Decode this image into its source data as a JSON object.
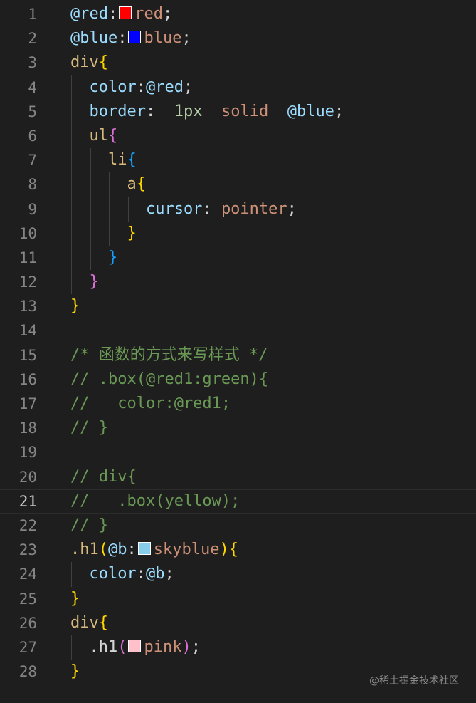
{
  "editor": {
    "lines": [
      {
        "number": "1",
        "guides": [],
        "tokens": [
          {
            "text": "@red",
            "color": "#9cdcfe"
          },
          {
            "text": ":",
            "color": "#d4d4d4"
          },
          {
            "swatch": "#ff0000"
          },
          {
            "text": "red",
            "color": "#ce9178"
          },
          {
            "text": ";",
            "color": "#d4d4d4"
          }
        ]
      },
      {
        "number": "2",
        "guides": [],
        "tokens": [
          {
            "text": "@blue",
            "color": "#9cdcfe"
          },
          {
            "text": ":",
            "color": "#d4d4d4"
          },
          {
            "swatch": "#0000ff"
          },
          {
            "text": "blue",
            "color": "#ce9178"
          },
          {
            "text": ";",
            "color": "#d4d4d4"
          }
        ]
      },
      {
        "number": "3",
        "guides": [],
        "tokens": [
          {
            "text": "div",
            "color": "#d7ba7d"
          },
          {
            "text": "{",
            "color": "#ffd700"
          }
        ]
      },
      {
        "number": "4",
        "guides": [
          1
        ],
        "tokens": [
          {
            "text": "  color",
            "color": "#9cdcfe"
          },
          {
            "text": ":",
            "color": "#d4d4d4"
          },
          {
            "text": "@red",
            "color": "#9cdcfe"
          },
          {
            "text": ";",
            "color": "#d4d4d4"
          }
        ]
      },
      {
        "number": "5",
        "guides": [
          1
        ],
        "tokens": [
          {
            "text": "  border",
            "color": "#9cdcfe"
          },
          {
            "text": ":  ",
            "color": "#d4d4d4"
          },
          {
            "text": "1px",
            "color": "#b5cea8"
          },
          {
            "text": "  ",
            "color": "#d4d4d4"
          },
          {
            "text": "solid",
            "color": "#ce9178"
          },
          {
            "text": "  ",
            "color": "#d4d4d4"
          },
          {
            "text": "@blue",
            "color": "#9cdcfe"
          },
          {
            "text": ";",
            "color": "#d4d4d4"
          }
        ]
      },
      {
        "number": "6",
        "guides": [
          1
        ],
        "tokens": [
          {
            "text": "  ul",
            "color": "#d7ba7d"
          },
          {
            "text": "{",
            "color": "#da70d6"
          }
        ]
      },
      {
        "number": "7",
        "guides": [
          1,
          2
        ],
        "tokens": [
          {
            "text": "    li",
            "color": "#d7ba7d"
          },
          {
            "text": "{",
            "color": "#179fff"
          }
        ]
      },
      {
        "number": "8",
        "guides": [
          1,
          2,
          3
        ],
        "tokens": [
          {
            "text": "      a",
            "color": "#d7ba7d"
          },
          {
            "text": "{",
            "color": "#ffd700"
          }
        ]
      },
      {
        "number": "9",
        "guides": [
          1,
          2,
          3,
          4
        ],
        "tokens": [
          {
            "text": "        cursor",
            "color": "#9cdcfe"
          },
          {
            "text": ": ",
            "color": "#d4d4d4"
          },
          {
            "text": "pointer",
            "color": "#ce9178"
          },
          {
            "text": ";",
            "color": "#d4d4d4"
          }
        ]
      },
      {
        "number": "10",
        "guides": [
          1,
          2,
          3
        ],
        "tokens": [
          {
            "text": "      }",
            "color": "#ffd700"
          }
        ]
      },
      {
        "number": "11",
        "guides": [
          1,
          2
        ],
        "tokens": [
          {
            "text": "    }",
            "color": "#179fff"
          }
        ]
      },
      {
        "number": "12",
        "guides": [
          1
        ],
        "tokens": [
          {
            "text": "  }",
            "color": "#da70d6"
          }
        ]
      },
      {
        "number": "13",
        "guides": [],
        "tokens": [
          {
            "text": "}",
            "color": "#ffd700"
          }
        ]
      },
      {
        "number": "14",
        "guides": [],
        "tokens": []
      },
      {
        "number": "15",
        "guides": [],
        "tokens": [
          {
            "text": "/* 函数的方式来写样式 */",
            "color": "#6a9955"
          }
        ]
      },
      {
        "number": "16",
        "guides": [],
        "tokens": [
          {
            "text": "// .box(@red1:green){",
            "color": "#6a9955"
          }
        ]
      },
      {
        "number": "17",
        "guides": [],
        "tokens": [
          {
            "text": "//   color:@red1;",
            "color": "#6a9955"
          }
        ]
      },
      {
        "number": "18",
        "guides": [],
        "tokens": [
          {
            "text": "// }",
            "color": "#6a9955"
          }
        ]
      },
      {
        "number": "19",
        "guides": [],
        "tokens": []
      },
      {
        "number": "20",
        "guides": [],
        "tokens": [
          {
            "text": "// div{",
            "color": "#6a9955"
          }
        ]
      },
      {
        "number": "21",
        "guides": [],
        "current": true,
        "tokens": [
          {
            "text": "//   .box(yellow);",
            "color": "#6a9955"
          }
        ]
      },
      {
        "number": "22",
        "guides": [],
        "tokens": [
          {
            "text": "// }",
            "color": "#6a9955"
          }
        ]
      },
      {
        "number": "23",
        "guides": [],
        "tokens": [
          {
            "text": ".h1",
            "color": "#d7ba7d"
          },
          {
            "text": "(",
            "color": "#ffd700"
          },
          {
            "text": "@b",
            "color": "#9cdcfe"
          },
          {
            "text": ":",
            "color": "#d4d4d4"
          },
          {
            "swatch": "#87ceeb"
          },
          {
            "text": "skyblue",
            "color": "#ce9178"
          },
          {
            "text": ")",
            "color": "#ffd700"
          },
          {
            "text": "{",
            "color": "#ffd700"
          }
        ]
      },
      {
        "number": "24",
        "guides": [
          1
        ],
        "tokens": [
          {
            "text": "  color",
            "color": "#9cdcfe"
          },
          {
            "text": ":",
            "color": "#d4d4d4"
          },
          {
            "text": "@b",
            "color": "#9cdcfe"
          },
          {
            "text": ";",
            "color": "#d4d4d4"
          }
        ]
      },
      {
        "number": "25",
        "guides": [],
        "tokens": [
          {
            "text": "}",
            "color": "#ffd700"
          }
        ]
      },
      {
        "number": "26",
        "guides": [],
        "tokens": [
          {
            "text": "div",
            "color": "#d7ba7d"
          },
          {
            "text": "{",
            "color": "#ffd700"
          }
        ]
      },
      {
        "number": "27",
        "guides": [
          1
        ],
        "tokens": [
          {
            "text": "  .h1",
            "color": "#d4d4d4"
          },
          {
            "text": "(",
            "color": "#da70d6"
          },
          {
            "swatch": "#ffc0cb"
          },
          {
            "text": "pink",
            "color": "#ce9178"
          },
          {
            "text": ")",
            "color": "#da70d6"
          },
          {
            "text": ";",
            "color": "#d4d4d4"
          }
        ]
      },
      {
        "number": "28",
        "guides": [],
        "tokens": [
          {
            "text": "}",
            "color": "#ffd700"
          }
        ]
      }
    ]
  },
  "watermark": "@稀土掘金技术社区"
}
